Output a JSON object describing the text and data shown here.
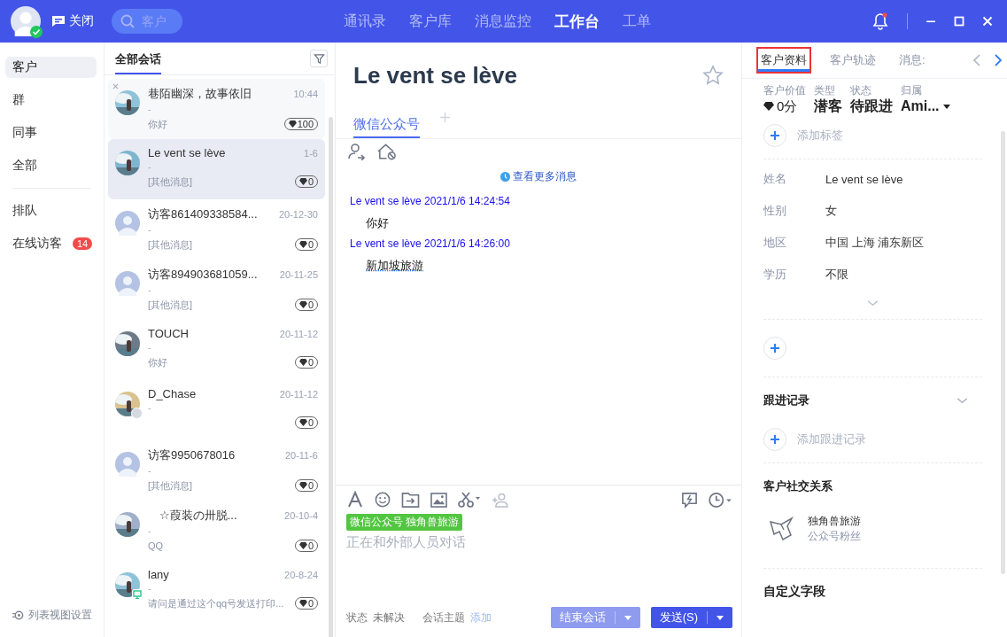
{
  "topbar": {
    "close_label": "关闭",
    "search": {
      "placeholder": "客户"
    },
    "nav": [
      {
        "label": "通讯录",
        "selected": false
      },
      {
        "label": "客户库",
        "selected": false
      },
      {
        "label": "消息监控",
        "selected": false
      },
      {
        "label": "工作台",
        "selected": true
      },
      {
        "label": "工单",
        "selected": false
      }
    ],
    "notification": true
  },
  "sidebar": {
    "items": [
      {
        "label": "客户",
        "selected": true,
        "divider_before": false
      },
      {
        "label": "群",
        "selected": false,
        "divider_before": false
      },
      {
        "label": "同事",
        "selected": false,
        "divider_before": false
      },
      {
        "label": "全部",
        "selected": false,
        "divider_before": false
      },
      {
        "label": "排队",
        "selected": false,
        "divider_before": true
      },
      {
        "label": "在线访客",
        "selected": false,
        "divider_before": false,
        "badge": "14"
      }
    ],
    "settings_label": "列表视图设置"
  },
  "conversations": {
    "title": "全部会话",
    "items": [
      {
        "name": "巷陌幽深，故事依旧",
        "time": "10:44",
        "sub": "-",
        "message": "你好",
        "score": "100",
        "selected": false,
        "closable": true,
        "offline": false,
        "on_pc": false
      },
      {
        "name": "Le vent se lève",
        "time": "1-6",
        "sub": "-",
        "message": "[其他消息]",
        "score": "0",
        "selected": true,
        "closable": false,
        "offline": false,
        "on_pc": false
      },
      {
        "name": "访客861409338584...",
        "time": "20-12-30",
        "sub": "-",
        "message": "[其他消息]",
        "score": "0",
        "selected": false,
        "closable": false,
        "kind": "default",
        "offline": false,
        "on_pc": false
      },
      {
        "name": "访客894903681059...",
        "time": "20-11-25",
        "sub": "-",
        "message": "[其他消息]",
        "score": "0",
        "selected": false,
        "closable": false,
        "kind": "default",
        "offline": false,
        "on_pc": false
      },
      {
        "name": "TOUCH",
        "time": "20-11-12",
        "sub": "-",
        "message": "你好",
        "score": "0",
        "selected": false,
        "closable": false,
        "offline": false,
        "on_pc": false
      },
      {
        "name": "D_Chase",
        "time": "20-11-12",
        "sub": "-",
        "score": "0",
        "selected": false,
        "closable": false,
        "offline": true,
        "on_pc": false
      },
      {
        "name": "访客9950678016",
        "time": "20-11-6",
        "sub": "-",
        "message": "[其他消息]",
        "score": "0",
        "selected": false,
        "closable": false,
        "kind": "default",
        "offline": false,
        "on_pc": false
      },
      {
        "name": "　☆葭装の卅脱...",
        "time": "20-10-4",
        "sub": "-",
        "message": "QQ",
        "score": "0",
        "selected": false,
        "closable": false,
        "offline": false,
        "on_pc": false
      },
      {
        "name": "lany",
        "time": "20-8-24",
        "sub": "-",
        "message": "请问是通过这个qq号发送打印...",
        "score": "0",
        "selected": false,
        "closable": false,
        "offline": false,
        "on_pc": true
      }
    ]
  },
  "chat": {
    "title": "Le vent se lève",
    "starred": false,
    "channels": [
      {
        "label": "微信公众号",
        "selected": true
      }
    ],
    "more_label": "查看更多消息",
    "messages": [
      {
        "header": "Le vent se lève 2021/1/6 14:24:54",
        "text": "你好",
        "underlined": false
      },
      {
        "header": "Le vent se lève 2021/1/6 14:26:00",
        "text": "新加坡旅游",
        "underlined": true
      }
    ],
    "composer": {
      "tag": "微信公众号 独角兽旅游",
      "placeholder": "正在和外部人员对话"
    },
    "footer": {
      "status_label": "状态",
      "status_value": "未解决",
      "topic_label": "会话主题",
      "topic_action": "添加",
      "end_label": "结束会话",
      "send_label": "发送(S)"
    }
  },
  "profile": {
    "tabs": [
      {
        "label": "客户资料",
        "selected": true,
        "highlighted": true
      },
      {
        "label": "客户轨迹",
        "selected": false,
        "highlighted": false
      },
      {
        "label": "消息:",
        "selected": false,
        "highlighted": false
      }
    ],
    "summary": [
      {
        "label": "客户价值",
        "value": "0分",
        "kind": "score"
      },
      {
        "label": "类型",
        "value": "潜客",
        "kind": "text"
      },
      {
        "label": "状态",
        "value": "待跟进",
        "kind": "text"
      },
      {
        "label": "归属",
        "value": "Ami...",
        "kind": "dropdown"
      }
    ],
    "add_tag_label": "添加标签",
    "fields": [
      {
        "label": "姓名",
        "value": "Le vent se lève"
      },
      {
        "label": "性别",
        "value": "女"
      },
      {
        "label": "地区",
        "value": "中国 上海 浦东新区"
      },
      {
        "label": "学历",
        "value": "不限"
      }
    ],
    "followup": {
      "title": "跟进记录",
      "add_label": "添加跟进记录"
    },
    "social": {
      "title": "客户社交关系",
      "items": [
        {
          "name": "独角兽旅游",
          "role": "公众号粉丝"
        }
      ]
    },
    "custom_title": "自定义字段"
  }
}
